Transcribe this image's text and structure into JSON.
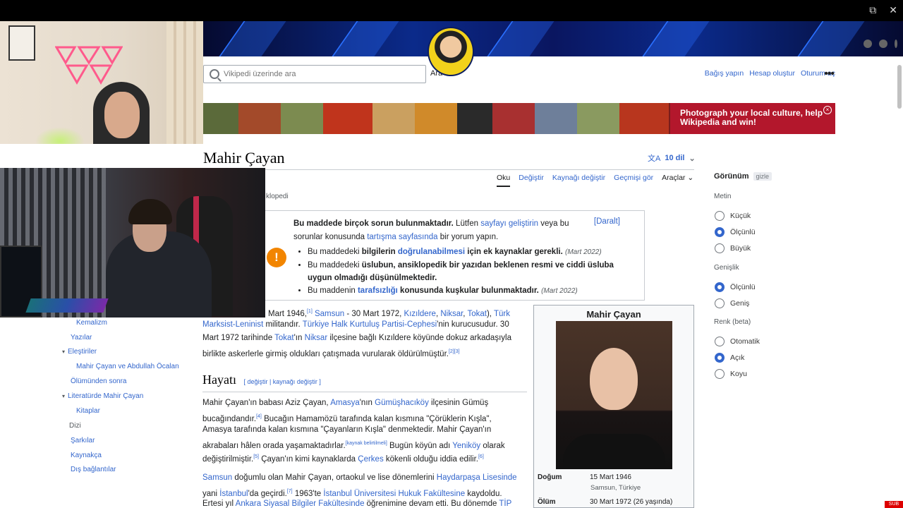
{
  "header": {
    "search_placeholder": "Vikipedi üzerinde ara",
    "search_button": "Ara",
    "user_links": [
      "Bağış yapın",
      "Hesap oluştur",
      "Oturum aç"
    ],
    "more_label": "•••"
  },
  "window": {
    "restore": "⧉",
    "close": "✕"
  },
  "banner": {
    "text": "Photograph your local culture, help Wikipedia and win!",
    "close": "×"
  },
  "page": {
    "title": "Mahir Çayan",
    "languages": "10 dil",
    "tabs": [
      "Oku",
      "Değiştir",
      "Kaynağı değiştir",
      "Geçmişi gör",
      "Araçlar"
    ],
    "tagline": "klopedi"
  },
  "notice": {
    "icon": "!",
    "main_1": "Bu maddede birçok sorun bulunmaktadır.",
    "main_2": " Lütfen ",
    "main_link1": "sayfayı geliştirin",
    "main_3": " veya bu sorunlar konusunda ",
    "main_link2": "tartışma sayfasında",
    "main_4": " bir yorum yapın.",
    "toggle": "[Daralt]",
    "items": [
      {
        "a": "Bu maddedeki ",
        "b": "bilgilerin ",
        "link": "doğrulanabilmesi",
        "c": " için ek kaynaklar gerekli.",
        "date": "(Mart 2022)"
      },
      {
        "a": "Bu maddedeki ",
        "b": "üslubun, ansiklopedik bir yazıdan beklenen resmi ve ciddi üsluba uygun olmadığı düşünülmektedir.",
        "link": "",
        "c": "",
        "date": ""
      },
      {
        "a": "Bu maddenin ",
        "b": "",
        "link": "tarafsızlığı",
        "c": " konusunda kuşkular bulunmaktadır.",
        "date": "(Mart 2022)"
      }
    ]
  },
  "lead": {
    "l1_a": "Mart 1946,",
    "l1_sup": "[1]",
    "l1_link1": "Samsun",
    "l1_b": " - 30 Mart 1972, ",
    "l1_link2": "Kızıldere",
    "l1_c": ", ",
    "l1_link3": "Niksar",
    "l1_d": ", ",
    "l1_link4": "Tokat",
    "l1_e": "), ",
    "l1_link5": "Türk",
    "l2_link1": "Marksist-Leninist",
    "l2_a": " militandır. ",
    "l2_link2": "Türkiye Halk Kurtuluş Partisi-Cephesi",
    "l2_b": "'nin kurucusudur. 30",
    "l3_a": "Mart 1972 tarihinde ",
    "l3_link1": "Tokat",
    "l3_b": "'ın ",
    "l3_link2": "Niksar",
    "l3_c": " ilçesine bağlı Kızıldere köyünde dokuz arkadaşıyla",
    "l4_a": "birlikte askerlerle girmiş oldukları çatışmada vurularak öldürülmüştür.",
    "l4_sup": "[2][3]"
  },
  "section": {
    "title": "Hayatı",
    "edit": "[ değiştir | kaynağı değiştir ]"
  },
  "body": {
    "p1_a": "Mahir Çayan'ın babası Aziz Çayan, ",
    "p1_link1": "Amasya",
    "p1_b": "'nın ",
    "p1_link2": "Gümüşhacıköy",
    "p1_c": " ilçesinin Gümüş",
    "p2_a": "bucağındandır.",
    "p2_sup": "[4]",
    "p2_b": " Bucağın Hamamözü tarafında kalan kısmına \"Çörüklerin Kışla\",",
    "p3_a": "Amasya tarafında kalan kısmına \"Çayanların Kışla\" denmektedir. Mahir Çayan'ın",
    "p4_a": "akrabaları hâlen orada yaşamaktadırlar.",
    "p4_sup": "[kaynak belirtilmeli]",
    "p4_b": " Bugün köyün adı ",
    "p4_link": "Yeniköy",
    "p4_c": " olarak",
    "p5_a": "değiştirilmiştir.",
    "p5_sup": "[5]",
    "p5_b": " Çayan'ın kimi kaynaklarda ",
    "p5_link": "Çerkes",
    "p5_c": " kökenli olduğu iddia edilir.",
    "p5_sup2": "[6]",
    "p6_link1": "Samsun",
    "p6_a": " doğumlu olan Mahir Çayan, ortaokul ve lise dönemlerini ",
    "p6_link2": "Haydarpaşa Lisesinde",
    "p7_a": "yani ",
    "p7_link1": "İstanbul",
    "p7_b": "'da geçirdi.",
    "p7_sup": "[7]",
    "p7_c": " 1963'te ",
    "p7_link2": "İstanbul Üniversitesi Hukuk Fakültesine",
    "p7_d": " kaydoldu.",
    "p8_a": "Ertesi yıl ",
    "p8_link1": "Ankara Siyasal Bilgiler Fakültesinde",
    "p8_b": " öğrenimine devam etti. Bu dönemde ",
    "p8_link2": "TİP"
  },
  "infobox": {
    "title": "Mahir Çayan",
    "birth_label": "Doğum",
    "birth_date": "15 Mart 1946",
    "birth_place": "Samsun, Türkiye",
    "death_label": "Ölüm",
    "death_date": "30 Mart 1972 (26 yaşında)"
  },
  "appearance": {
    "title": "Görünüm",
    "hide": "gizle",
    "text_label": "Metin",
    "text_options": [
      "Küçük",
      "Ölçünlü",
      "Büyük"
    ],
    "text_selected": "Ölçünlü",
    "width_label": "Genişlik",
    "width_options": [
      "Ölçünlü",
      "Geniş"
    ],
    "width_selected": "Ölçünlü",
    "color_label": "Renk (beta)",
    "color_options": [
      "Otomatik",
      "Açık",
      "Koyu"
    ],
    "color_selected": "Açık"
  },
  "toc": {
    "items": [
      "Kemalizm",
      "Yazılar",
      "Eleştiriler",
      "Mahir Çayan ve Abdullah Öcalan",
      "Ölümünden sonra",
      "Literatürde Mahir Çayan",
      "Kitaplar",
      "Dizi",
      "Şarkılar",
      "Kaynakça",
      "Dış bağlantılar"
    ]
  },
  "badge": "SUB",
  "colors": {
    "link": "#3366cc",
    "banner_red": "#b3172c",
    "notice_orange": "#f28500"
  }
}
